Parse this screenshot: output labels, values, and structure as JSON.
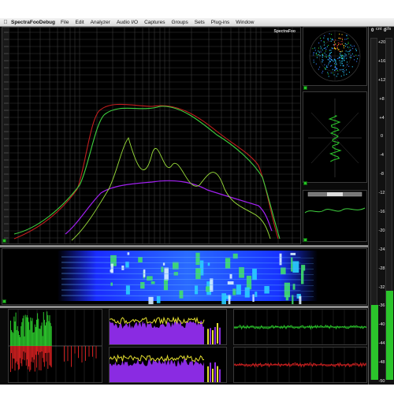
{
  "menubar": {
    "apple_icon": "apple-menu-icon",
    "app_name": "SpectraFooDebug",
    "items": [
      "File",
      "Edit",
      "Analyzer",
      "Audio I/O",
      "Captures",
      "Groups",
      "Sets",
      "Plug-ins",
      "Window"
    ]
  },
  "spectrum": {
    "tag": "SpectraFoo",
    "colors": {
      "peak_red": "#c21e1e",
      "avg_green": "#3fd23f",
      "violet": "#a020f0",
      "yellow": "#e3e23a"
    }
  },
  "meter": {
    "head_left": "0",
    "head_right": "0",
    "sub_left": "cnt",
    "sub_right": "cfs",
    "scale": [
      "+20",
      "+16",
      "+12",
      "+8",
      "+4",
      "0",
      "-4",
      "-8",
      "-12",
      "-16",
      "-20",
      "-24",
      "-28",
      "-32",
      "-36",
      "-40",
      "-44",
      "-48",
      "-50"
    ],
    "left_level": 0.22,
    "right_level": 0.26
  },
  "colors": {
    "background": "#000000",
    "grid": "#3b3b3b",
    "green": "#2bc42b",
    "red": "#d02020",
    "violet": "#8a2be2",
    "yellow": "#e6e030",
    "spectrogram_blue": "#1f3cff"
  }
}
